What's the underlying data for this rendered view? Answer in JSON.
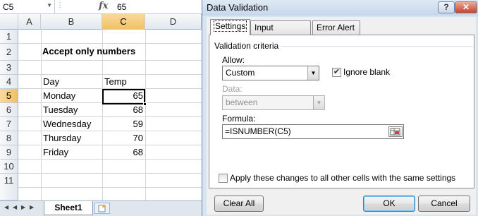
{
  "excel": {
    "name_box": "C5",
    "fx_symbol": "fx",
    "formula_value": "65",
    "columns": [
      "A",
      "B",
      "C",
      "D"
    ],
    "rows": [
      "1",
      "2",
      "3",
      "4",
      "5",
      "6",
      "7",
      "8",
      "9",
      "10",
      "11"
    ],
    "selected_column": "C",
    "selected_row": "5",
    "title": "Accept only numbers",
    "table": {
      "headers": [
        "Day",
        "Temp"
      ],
      "rows": [
        {
          "day": "Monday",
          "temp": "65"
        },
        {
          "day": "Tuesday",
          "temp": "68"
        },
        {
          "day": "Wednesday",
          "temp": "59"
        },
        {
          "day": "Thursday",
          "temp": "70"
        },
        {
          "day": "Friday",
          "temp": "68"
        }
      ]
    },
    "sheet_tab": "Sheet1"
  },
  "dialog": {
    "title": "Data Validation",
    "help_glyph": "?",
    "close_glyph": "✕",
    "tabs": [
      {
        "label": "Settings",
        "active": true
      },
      {
        "label": "Input Message",
        "active": false
      },
      {
        "label": "Error Alert",
        "active": false
      }
    ],
    "group_label": "Validation criteria",
    "allow_label": "Allow:",
    "allow_value": "Custom",
    "ignore_blank_label": "Ignore blank",
    "ignore_blank_checked": true,
    "data_label": "Data:",
    "data_value": "between",
    "formula_label": "Formula:",
    "formula_value": "=ISNUMBER(C5)",
    "apply_label": "Apply these changes to all other cells with the same settings",
    "apply_checked": false,
    "buttons": {
      "clear_all": "Clear All",
      "ok": "OK",
      "cancel": "Cancel"
    }
  },
  "colors": {
    "dialog_frame": "#d9e4f1",
    "selected_header": "#f1c15f",
    "close_button": "#c4442d"
  }
}
